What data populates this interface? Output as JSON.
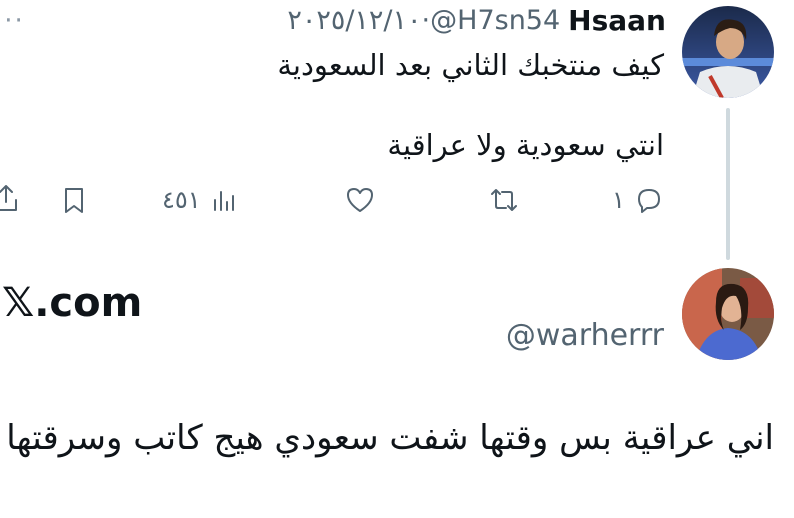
{
  "reply": {
    "display_name": "Hsaan",
    "handle": "@H7sn54",
    "separator": "·",
    "date": "٢٠٢٥/١٢/١٠",
    "text_line1": "كيف منتخبك الثاني بعد السعودية",
    "text_line2": "انتي سعودية ولا عراقية",
    "actions": {
      "reply_count": "١",
      "retweet_count": "",
      "like_count": "",
      "views_count": "٤٥١"
    },
    "more_glyph": "···"
  },
  "card": {
    "brand": "𝕏.com",
    "handle": "@warherrr",
    "text": "اني عراقية بس وقتها شفت سعودي هيج كاتب وسرقتها"
  },
  "colors": {
    "text": "#0f1419",
    "secondary": "#536471",
    "thread_line": "#cfd9de"
  }
}
